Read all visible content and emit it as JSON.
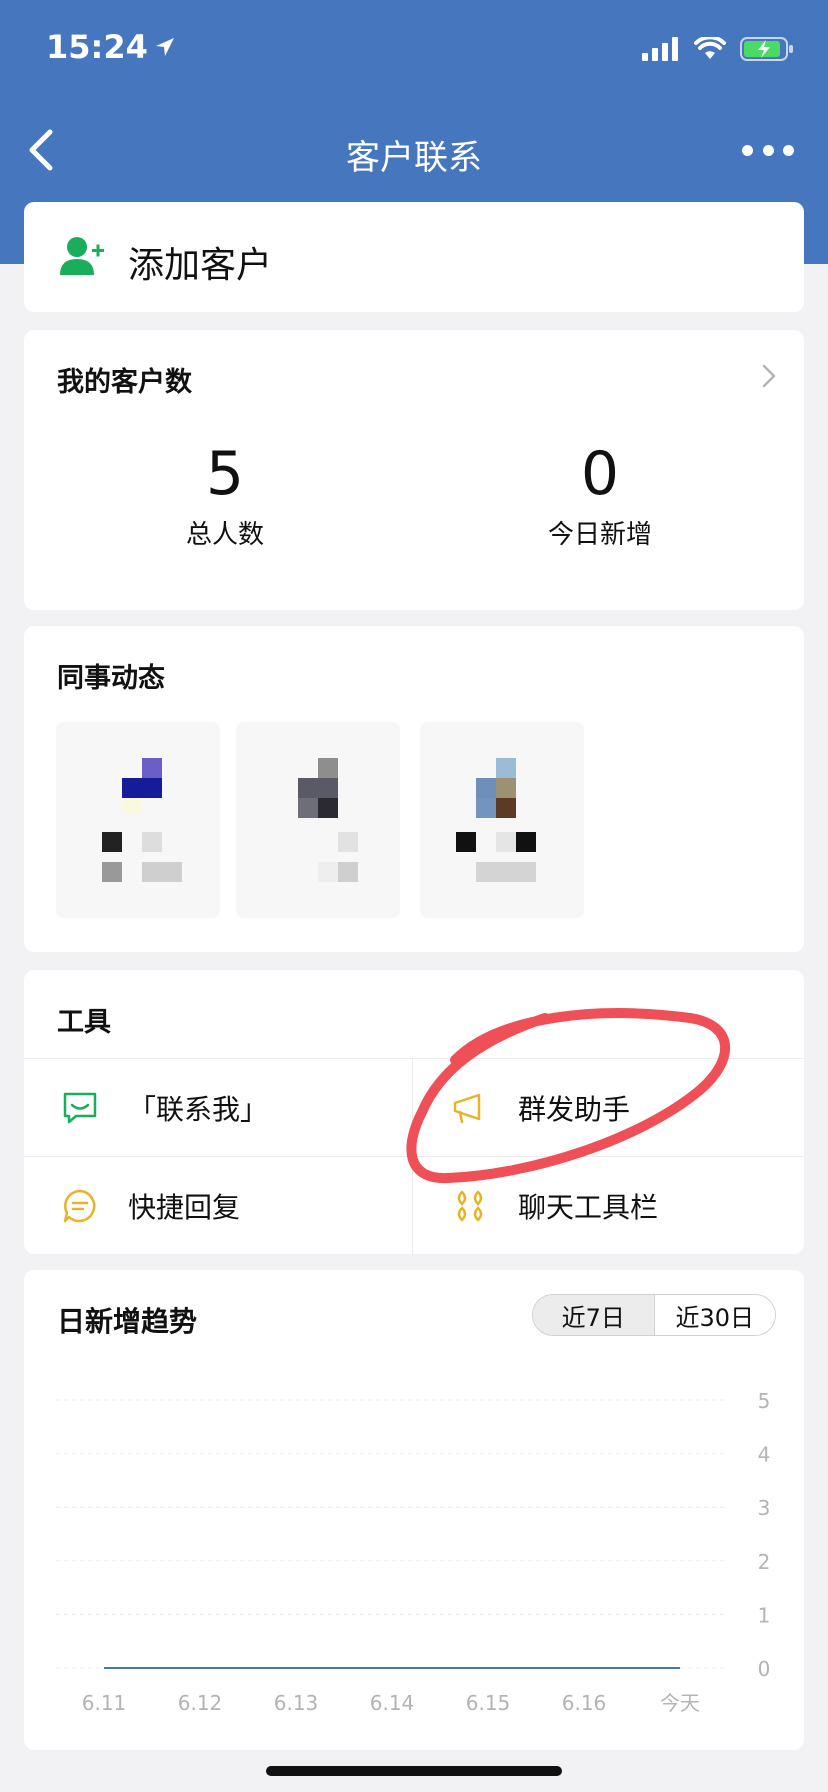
{
  "status_bar": {
    "time": "15:24"
  },
  "navbar": {
    "title": "客户联系"
  },
  "add_customer": {
    "label": "添加客户"
  },
  "customer_count": {
    "title": "我的客户数",
    "total": {
      "value": "5",
      "label": "总人数"
    },
    "today_new": {
      "value": "0",
      "label": "今日新增"
    }
  },
  "colleague_activity": {
    "title": "同事动态"
  },
  "tools": {
    "title": "工具",
    "items": [
      {
        "label": "「联系我」",
        "icon": "contact-me-icon",
        "color": "#1aad5b"
      },
      {
        "label": "群发助手",
        "icon": "megaphone-icon",
        "color": "#e8b32a"
      },
      {
        "label": "快捷回复",
        "icon": "quick-reply-icon",
        "color": "#e8b32a"
      },
      {
        "label": "聊天工具栏",
        "icon": "toolbar-icon",
        "color": "#e8b32a"
      }
    ]
  },
  "trend": {
    "title": "日新增趋势",
    "tab_7": "近7日",
    "tab_30": "近30日",
    "selected_tab": "近7日"
  },
  "chart_data": {
    "type": "line",
    "categories": [
      "6.11",
      "6.12",
      "6.13",
      "6.14",
      "6.15",
      "6.16",
      "今天"
    ],
    "series": [
      {
        "values": [
          0,
          0,
          0,
          0,
          0,
          0,
          0
        ]
      }
    ],
    "y_ticks": [
      "0",
      "1",
      "2",
      "3",
      "4",
      "5"
    ],
    "ylim": [
      0,
      5
    ],
    "grid": true,
    "line_color": "#4676bd"
  },
  "colors": {
    "header": "#4676bd",
    "accent_green": "#1aad5b",
    "accent_yellow": "#e8b32a",
    "annotation_red": "#ef4f56"
  }
}
